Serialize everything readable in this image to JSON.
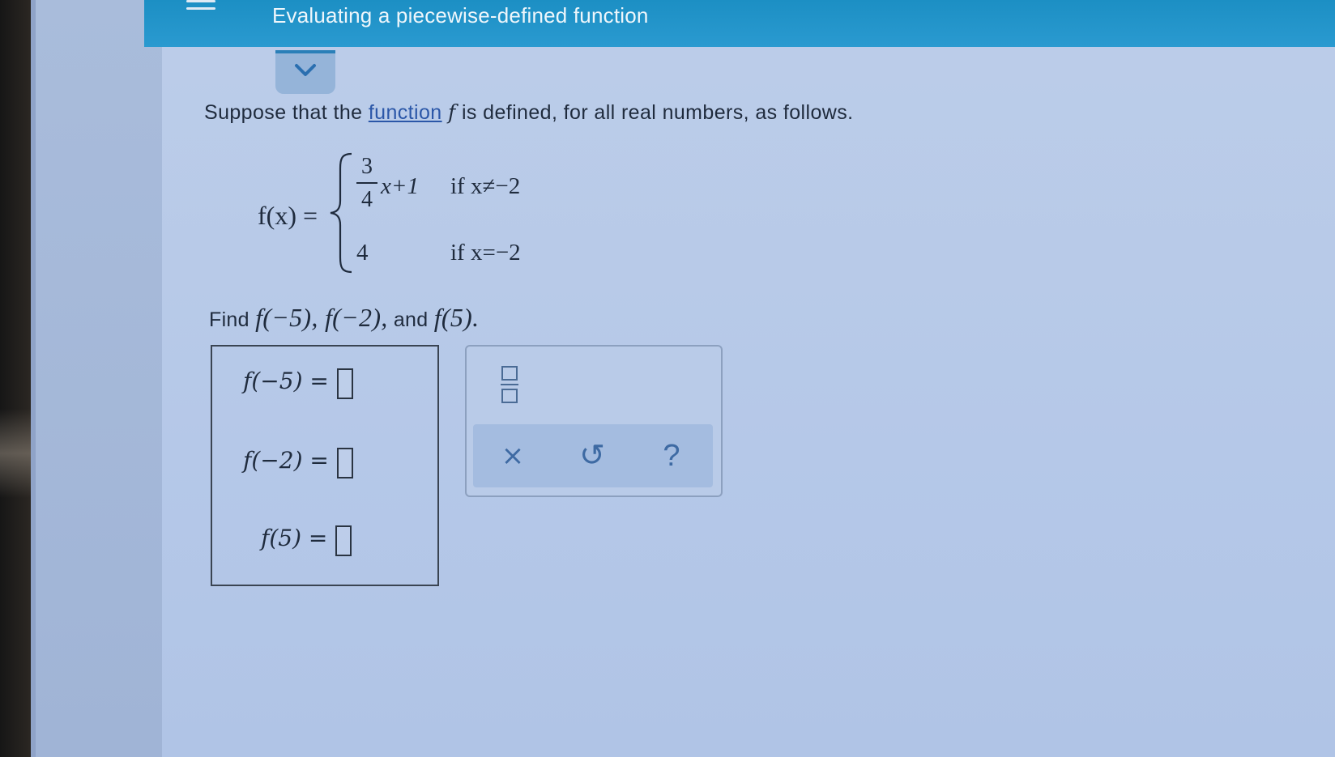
{
  "header": {
    "title": "Evaluating a piecewise-defined function"
  },
  "problem": {
    "intro_before": "Suppose that the",
    "link": "function",
    "fn": "f",
    "intro_after": "is defined, for all real numbers, as follows.",
    "lhs": "f(x) =",
    "case1": {
      "numerator": "3",
      "denominator": "4",
      "expr": "x+1",
      "condition": "if x≠−2"
    },
    "case2": {
      "value": "4",
      "condition": "if x=−2"
    },
    "find_label": "Find",
    "find_args": "f(−5), f(−2),",
    "find_and": "and",
    "find_last": "f(5)."
  },
  "answers": {
    "row1": "f(−5) =",
    "row2": "f(−2) =",
    "row3": "f(5) ="
  },
  "toolpad": {
    "clear": "×",
    "undo": "↺",
    "help": "?"
  }
}
